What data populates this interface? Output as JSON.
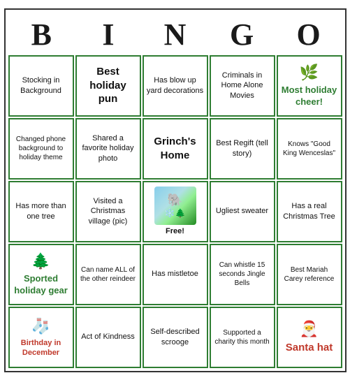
{
  "header": {
    "letters": [
      "B",
      "I",
      "N",
      "G",
      "O"
    ]
  },
  "cells": [
    {
      "id": "b1",
      "text": "Stocking in Background",
      "icon": "",
      "style": "normal"
    },
    {
      "id": "i1",
      "text": "Best holiday pun",
      "icon": "",
      "style": "big-text"
    },
    {
      "id": "n1",
      "text": "Has blow up yard decorations",
      "icon": "",
      "style": "normal"
    },
    {
      "id": "g1",
      "text": "Criminals in Home Alone Movies",
      "icon": "",
      "style": "normal"
    },
    {
      "id": "o1",
      "text": "Most holiday cheer!",
      "icon": "🌿",
      "style": "special-green"
    },
    {
      "id": "b2",
      "text": "Changed phone background to holiday theme",
      "icon": "",
      "style": "small"
    },
    {
      "id": "i2",
      "text": "Shared a favorite holiday photo",
      "icon": "",
      "style": "normal"
    },
    {
      "id": "n2",
      "text": "Grinch's Home",
      "icon": "",
      "style": "big-text"
    },
    {
      "id": "g2",
      "text": "Best Regift (tell story)",
      "icon": "",
      "style": "normal"
    },
    {
      "id": "o2",
      "text": "Knows \"Good King Wenceslas\"",
      "icon": "",
      "style": "normal"
    },
    {
      "id": "b3",
      "text": "Has more than one tree",
      "icon": "",
      "style": "normal"
    },
    {
      "id": "i3",
      "text": "Visited a Christmas village (pic)",
      "icon": "",
      "style": "normal"
    },
    {
      "id": "n3",
      "text": "Free!",
      "icon": "free-image",
      "style": "free"
    },
    {
      "id": "g3",
      "text": "Ugliest sweater",
      "icon": "",
      "style": "normal"
    },
    {
      "id": "o3",
      "text": "Has a real Christmas Tree",
      "icon": "",
      "style": "normal"
    },
    {
      "id": "b4",
      "text": "Sported holiday gear",
      "icon": "🌲",
      "style": "special-green"
    },
    {
      "id": "i4",
      "text": "Can name ALL of the other reindeer",
      "icon": "",
      "style": "normal"
    },
    {
      "id": "n4",
      "text": "Has mistletoe",
      "icon": "",
      "style": "normal"
    },
    {
      "id": "g4",
      "text": "Can whistle 15 seconds Jingle Bells",
      "icon": "",
      "style": "normal"
    },
    {
      "id": "o4",
      "text": "Best Mariah Carey reference",
      "icon": "",
      "style": "normal"
    },
    {
      "id": "b5",
      "text": "Birthday in December",
      "icon": "🧦",
      "style": "special-icon"
    },
    {
      "id": "i5",
      "text": "Act of Kindness",
      "icon": "",
      "style": "normal"
    },
    {
      "id": "n5",
      "text": "Self-described scrooge",
      "icon": "",
      "style": "normal"
    },
    {
      "id": "g5",
      "text": "Supported a charity this month",
      "icon": "",
      "style": "normal"
    },
    {
      "id": "o5",
      "text": "Santa hat",
      "icon": "🎅",
      "style": "special-green-big"
    }
  ]
}
